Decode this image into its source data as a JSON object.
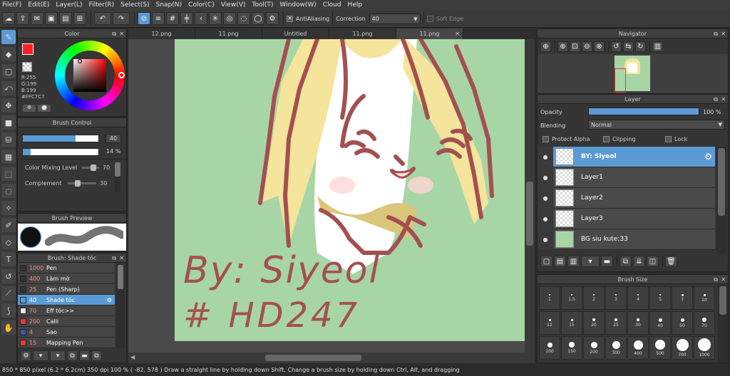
{
  "menu": [
    "File(F)",
    "Edit(E)",
    "Layer(L)",
    "Filter(R)",
    "Select(S)",
    "Snap(N)",
    "Color(C)",
    "View(V)",
    "Tool(T)",
    "Window(W)",
    "Cloud",
    "Help"
  ],
  "toolbar": {
    "antialias_label": "AntiAliasing",
    "correction_label": "Correction",
    "correction_value": "40",
    "soft_edge_label": "Soft Edge"
  },
  "color_panel": {
    "title": "Color",
    "r": "R:255",
    "g": "G:199",
    "b": "B:199",
    "hex": "#FFC7C7",
    "fg_color": "#ff2020",
    "bg_color": "#f3e6b0"
  },
  "brush_control": {
    "title": "Brush Control",
    "size_value": "40",
    "opacity_value": "14 %",
    "size_fraction": 0.7,
    "opacity_fraction": 0.1,
    "color_mixing_label": "Color Mixing Level",
    "color_mixing_value": "70",
    "complement_label": "Complement",
    "complement_value": "30"
  },
  "brush_preview": {
    "title": "Brush Preview"
  },
  "brush_list": {
    "title": "Brush: Shade tóc",
    "items": [
      {
        "size": "1000",
        "name": "Pen",
        "color": "#333333"
      },
      {
        "size": "400",
        "name": "Làm mờ",
        "color": "#333333"
      },
      {
        "size": "25",
        "name": "Pen (Sharp)",
        "color": "#333333"
      },
      {
        "size": "40",
        "name": "Shade tóc",
        "color": "#5b9bd5",
        "selected": true
      },
      {
        "size": "70",
        "name": "Eff tóc>>",
        "color": "#e8e8e8"
      },
      {
        "size": "200",
        "name": "Calli",
        "color": "#e53935"
      },
      {
        "size": "4",
        "name": "Sao",
        "color": "#3f51b5"
      },
      {
        "size": "15",
        "name": "Mapping Pen",
        "color": "#e53935"
      }
    ]
  },
  "tabs": [
    {
      "label": "12.png"
    },
    {
      "label": "11.png"
    },
    {
      "label": "Untitled"
    },
    {
      "label": "11.png"
    },
    {
      "label": "11.png",
      "active": true
    }
  ],
  "canvas": {
    "signature_line1": "By: Siyeol",
    "signature_line2": "# HD247",
    "background": "#a8d5a6"
  },
  "navigator": {
    "title": "Navigator"
  },
  "layer_panel": {
    "title": "Layer",
    "opacity_label": "Opacity",
    "opacity_value": "100 %",
    "opacity_fraction": 1.0,
    "blending_label": "Blending",
    "blending_value": "Normal",
    "protect_alpha": "Protect Alpha",
    "clipping": "Clipping",
    "lock": "Lock",
    "layers": [
      {
        "name": "BY: Siyeol",
        "selected": true
      },
      {
        "name": "Layer1"
      },
      {
        "name": "Layer2"
      },
      {
        "name": "Layer3"
      },
      {
        "name": "BG siu kute:33"
      }
    ]
  },
  "brush_size": {
    "title": "Brush Size",
    "sizes": [
      "1",
      "1.5",
      "2",
      "3",
      "4",
      "5",
      "7",
      "10",
      "12",
      "15",
      "20",
      "25",
      "30",
      "40",
      "50",
      "70",
      "100",
      "150",
      "200",
      "300",
      "400",
      "500",
      "700",
      "1000"
    ]
  },
  "status": {
    "text": "850 * 850 pixel   (6.2 * 6.2cm)   350 dpi   100 %   ( -82, 578 )   Draw a straight line by holding down Shift, Change a brush size by holding down Ctrl, Alt, and dragging"
  }
}
